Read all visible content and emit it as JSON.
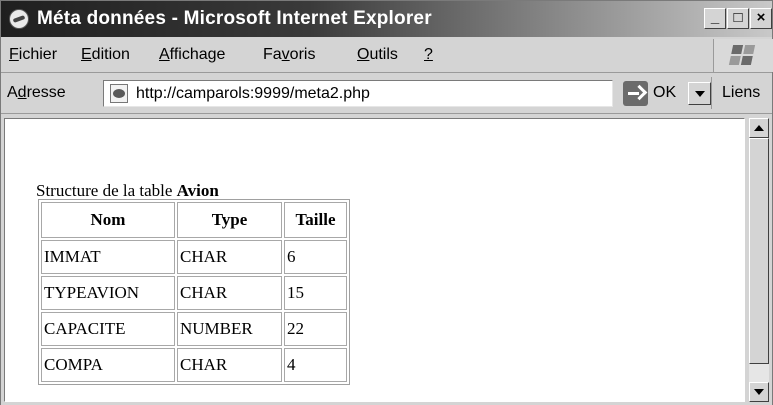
{
  "window": {
    "title": "Méta données - Microsoft Internet Explorer",
    "icon": "ie-icon",
    "controls": {
      "minimize": "_",
      "maximize": "□",
      "close": "×"
    }
  },
  "menu": {
    "items": [
      {
        "first": "F",
        "rest": "ichier"
      },
      {
        "first": "E",
        "rest": "dition"
      },
      {
        "first": "A",
        "rest": "ffichage"
      },
      {
        "pre": "Fa",
        "u": "v",
        "post": "oris"
      },
      {
        "first": "O",
        "rest": "utils"
      },
      {
        "first": "?",
        "rest": ""
      }
    ]
  },
  "address": {
    "label_pre": "A",
    "label_u": "d",
    "label_post": "resse",
    "url": "http://camparols:9999/meta2.php",
    "go_label": "OK",
    "links_label": "Liens"
  },
  "page": {
    "heading_prefix": "Structure de la table ",
    "heading_table": "Avion",
    "table": {
      "headers": [
        "Nom",
        "Type",
        "Taille"
      ],
      "rows": [
        [
          "IMMAT",
          "CHAR",
          "6"
        ],
        [
          "TYPEAVION",
          "CHAR",
          "15"
        ],
        [
          "CAPACITE",
          "NUMBER",
          "22"
        ],
        [
          "COMPA",
          "CHAR",
          "4"
        ]
      ]
    }
  }
}
